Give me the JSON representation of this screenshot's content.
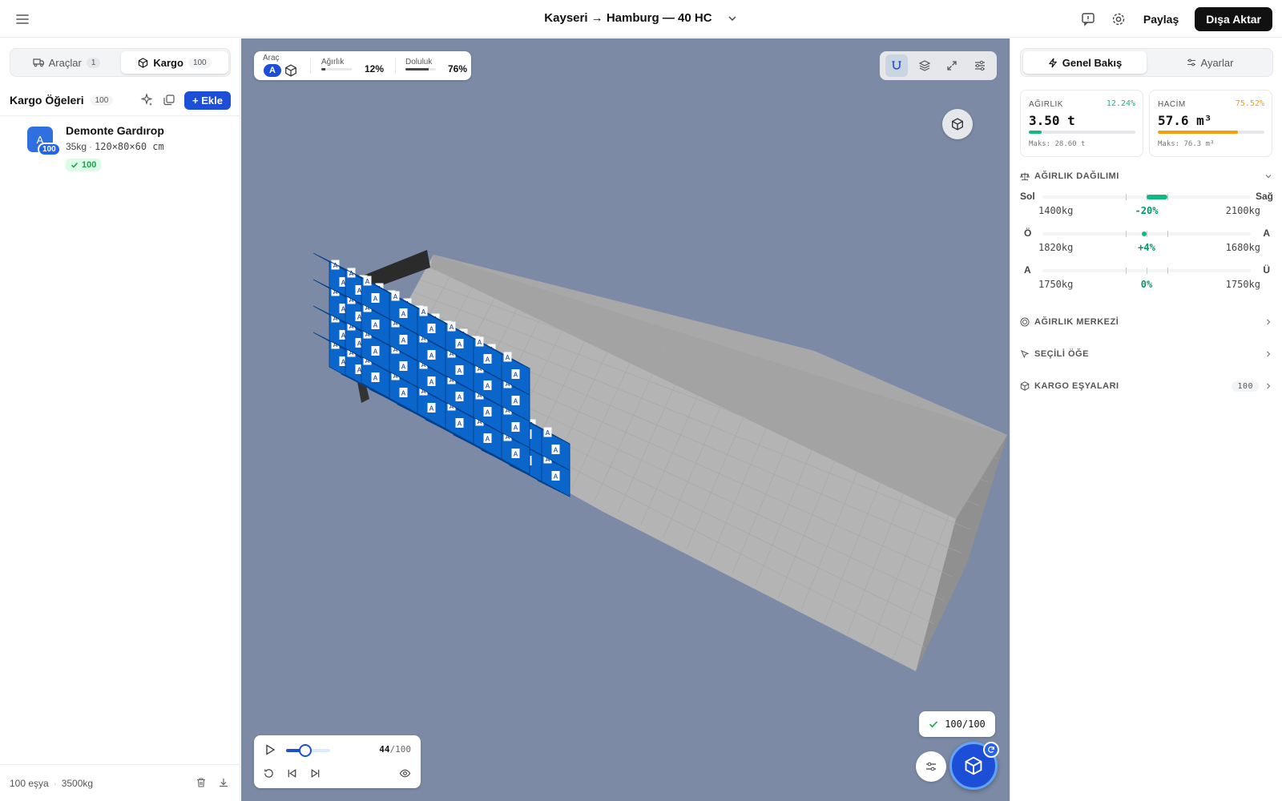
{
  "header": {
    "title": "Kayseri → Hamburg — 40 HC",
    "share_label": "Paylaş",
    "export_label": "Dışa Aktar"
  },
  "left": {
    "tabs": [
      {
        "label": "Araçlar",
        "count": "1"
      },
      {
        "label": "Kargo",
        "count": "100"
      }
    ],
    "list_title": "Kargo Öğeleri",
    "list_count": "100",
    "add_label": "Ekle",
    "items": [
      {
        "avatar": "A",
        "qty_badge": "100",
        "name": "Demonte Gardırop",
        "weight": "35kg",
        "dims": "120×80×60 cm",
        "placed": "100"
      }
    ],
    "footer": {
      "items": "100 eşya",
      "weight": "3500kg"
    }
  },
  "viewport": {
    "vehicle_label": "Araç",
    "vehicle_chip": "A",
    "weight_label": "Ağırlık",
    "weight_value": "12%",
    "weight_fraction": 0.12,
    "fill_label": "Doluluk",
    "fill_value": "76%",
    "fill_fraction": 0.76,
    "box_label": "A",
    "playback": {
      "current": "44",
      "total": "/100",
      "fraction": 0.44
    },
    "placed_status": "100/100"
  },
  "right": {
    "tabs": [
      "Genel Bakış",
      "Ayarlar"
    ],
    "weight_card": {
      "label": "AĞIRLIK",
      "percent": "12.24%",
      "value": "3.50 t",
      "max": "Maks: 28.60 t",
      "fraction": 0.1224
    },
    "volume_card": {
      "label": "HACİM",
      "percent": "75.52%",
      "value": "57.6 m³",
      "max": "Maks: 76.3 m³",
      "fraction": 0.7552
    },
    "distribution_title": "AĞIRLIK DAĞILIMI",
    "axes": [
      {
        "left": "Sol",
        "right": "Sağ",
        "left_value": "1400kg",
        "balance": "-20%",
        "right_value": "2100kg"
      },
      {
        "left": "Ö",
        "right": "A",
        "left_value": "1820kg",
        "balance": "+4%",
        "right_value": "1680kg"
      },
      {
        "left": "A",
        "right": "Ü",
        "left_value": "1750kg",
        "balance": "0%",
        "right_value": "1750kg"
      }
    ],
    "sections": [
      {
        "label": "AĞIRLIK MERKEZİ"
      },
      {
        "label": "SEÇİLİ ÖĞE"
      },
      {
        "label": "KARGO EŞYALARI",
        "count": "100"
      }
    ],
    "colors": {
      "weight_accent": "#10b981",
      "volume_accent": "#f59e0b"
    }
  },
  "colors": {
    "primary": "#1d4ed8",
    "viewport_bg": "#7c8aa5",
    "cargo_blue": "#0a64c8"
  }
}
